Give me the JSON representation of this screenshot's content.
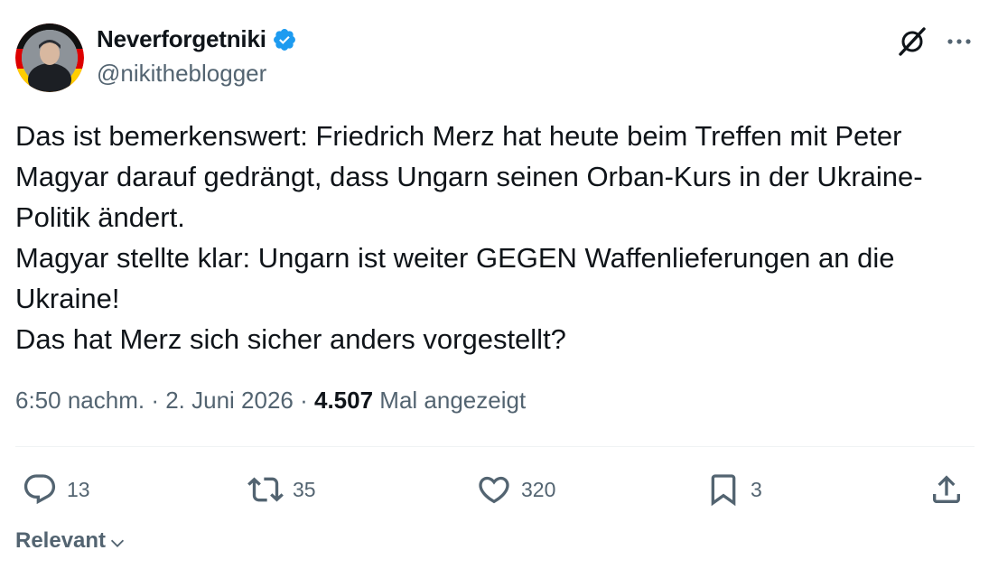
{
  "user": {
    "display_name": "Neverforgetniki",
    "handle": "@nikitheblogger",
    "verified": true,
    "verified_color": "#1d9bf0"
  },
  "tweet": {
    "lines": [
      "Das ist bemerkenswert: Friedrich Merz hat heute beim Treffen mit Peter",
      "Magyar darauf gedrängt, dass Ungarn seinen Orban-Kurs in der Ukraine-",
      "Politik ändert.",
      "Magyar stellte klar: Ungarn ist weiter GEGEN Waffenlieferungen an die",
      "Ukraine!",
      "Das hat Merz sich sicher anders vorgestellt?"
    ]
  },
  "meta": {
    "time": "6:50 nachm.",
    "separator": " · ",
    "date": "2. Juni 2026",
    "views_count": "4.507",
    "views_label": " Mal angezeigt"
  },
  "actions": {
    "replies": "13",
    "retweets": "35",
    "likes": "320",
    "bookmarks": "3"
  },
  "sort": {
    "label": "Relevant"
  },
  "icons": {
    "grok": "grok-icon",
    "more": "more-dots-icon",
    "reply": "reply-icon",
    "retweet": "retweet-icon",
    "like": "heart-icon",
    "bookmark": "bookmark-icon",
    "share": "share-icon",
    "chevron": "chevron-down-icon"
  },
  "colors": {
    "text_primary": "#0f1419",
    "text_secondary": "#536471",
    "divider": "#eff3f4"
  }
}
